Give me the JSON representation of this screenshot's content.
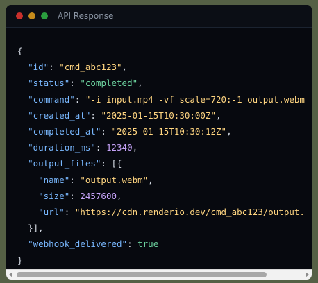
{
  "window": {
    "title": "API Response",
    "traffic_lights": [
      "#c9302c",
      "#c58b1b",
      "#2a9d3e"
    ]
  },
  "code": {
    "open_brace": "{",
    "close_brace": "}",
    "id": {
      "key": "\"id\"",
      "value": "\"cmd_abc123\""
    },
    "status": {
      "key": "\"status\"",
      "value": "\"completed\""
    },
    "command": {
      "key": "\"command\"",
      "value": "\"-i input.mp4 -vf scale=720:-1 output.webm"
    },
    "created_at": {
      "key": "\"created_at\"",
      "value": "\"2025-01-15T10:30:00Z\""
    },
    "completed_at": {
      "key": "\"completed_at\"",
      "value": "\"2025-01-15T10:30:12Z\""
    },
    "duration_ms": {
      "key": "\"duration_ms\"",
      "value": "12340"
    },
    "output_files": {
      "key": "\"output_files\"",
      "open": "[{",
      "close": "}],"
    },
    "file": {
      "name": {
        "key": "\"name\"",
        "value": "\"output.webm\""
      },
      "size": {
        "key": "\"size\"",
        "value": "2457600"
      },
      "url": {
        "key": "\"url\"",
        "value": "\"https://cdn.renderio.dev/cmd_abc123/output."
      }
    },
    "webhook_delivered": {
      "key": "\"webhook_delivered\"",
      "value": "true"
    }
  },
  "scrollbar": {
    "position": 0.0
  }
}
